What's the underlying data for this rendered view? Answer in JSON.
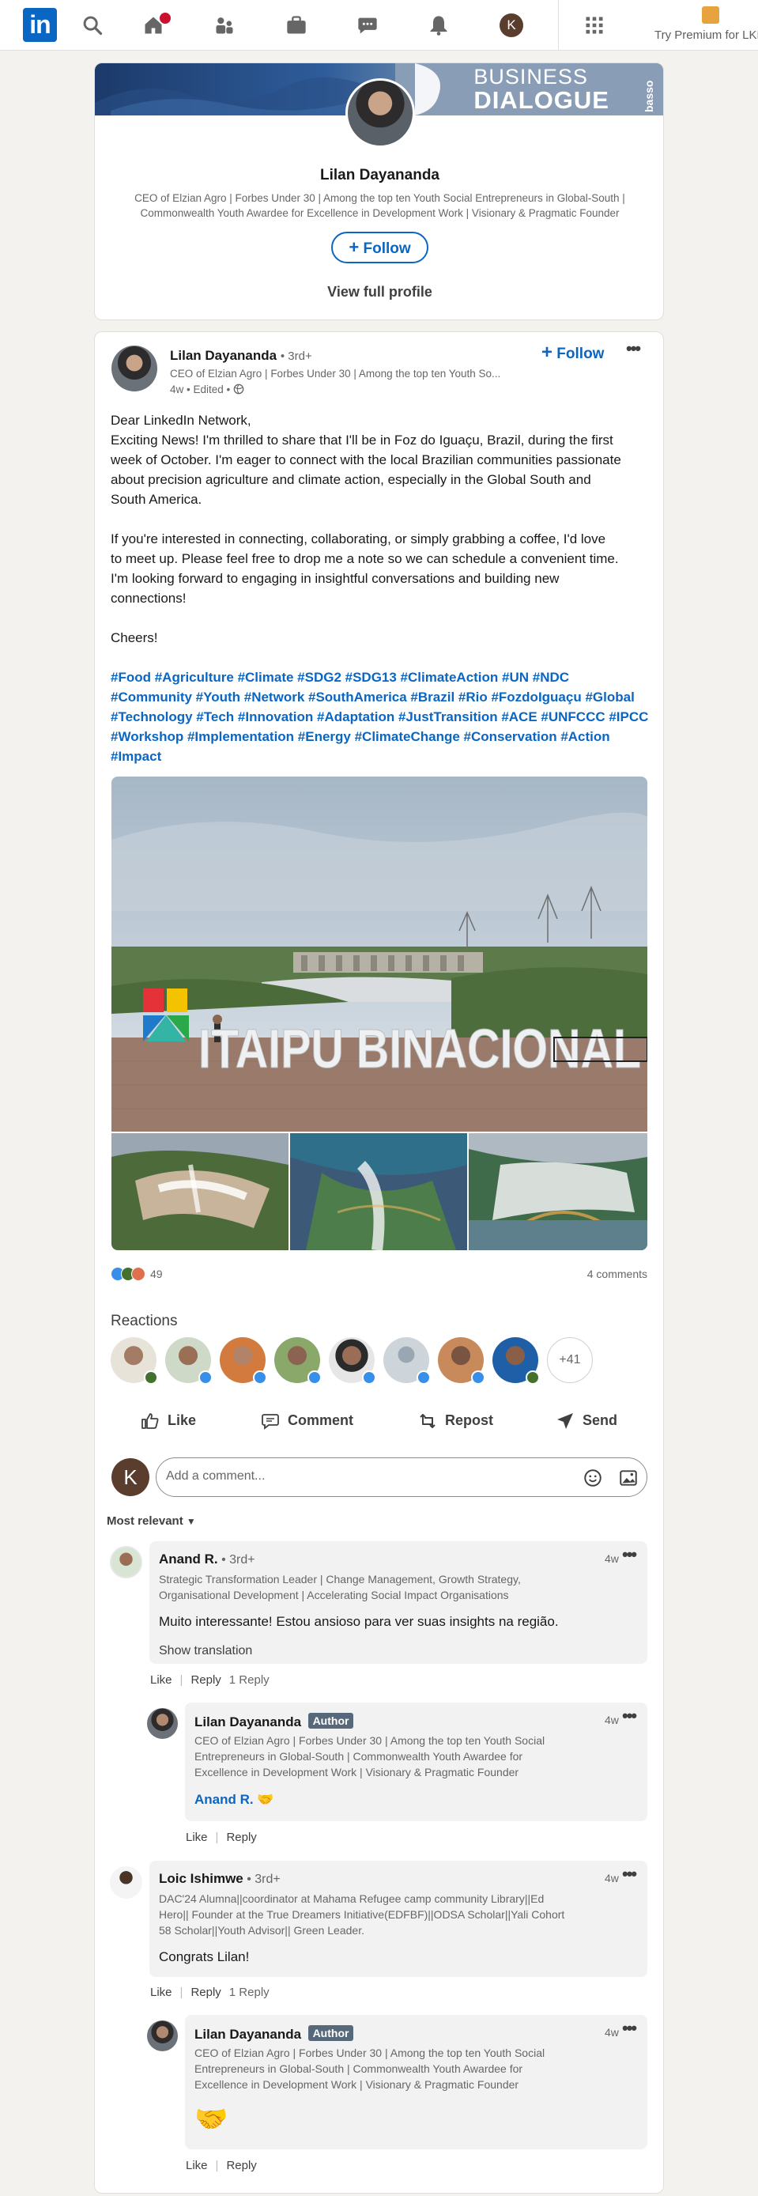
{
  "nav": {
    "logo": "in",
    "premium_label": "Try Premium for LKR"
  },
  "profile_card": {
    "banner_line1": "BUSINESS",
    "banner_line2": "DIALOGUE",
    "banner_side": "basso",
    "name": "Lilan Dayananda",
    "headline_l1": "CEO of Elzian Agro | Forbes Under 30 | Among the top ten Youth Social Entrepreneurs in Global-South |",
    "headline_l2": "Commonwealth Youth Awardee for Excellence in Development Work | Visionary & Pragmatic Founder",
    "follow_label": "Follow",
    "view_profile": "View full profile"
  },
  "post": {
    "author": "Lilan Dayananda",
    "degree": "• 3rd+",
    "headline": "CEO of Elzian Agro | Forbes Under 30 | Among the top ten Youth So...",
    "meta": "4w • Edited •",
    "follow_label": "Follow",
    "p1_l1": "Dear LinkedIn Network,",
    "p1_l2": "Exciting News! I'm thrilled to share that I'll be in Foz do Iguaçu, Brazil, during the first",
    "p1_l3": "week of October. I'm eager to connect with the local Brazilian communities passionate",
    "p1_l4": "about precision agriculture and climate action, especially in the Global South and",
    "p1_l5": "South America.",
    "p2_l1": "If you're interested in connecting, collaborating, or simply grabbing a coffee, I'd love",
    "p2_l2": "to meet up. Please feel free to drop me a note so we can schedule a convenient time.",
    "p2_l3": "I'm looking forward to engaging in insightful conversations and building new",
    "p2_l4": "connections!",
    "p3": "Cheers!",
    "tags_l1": "#Food #Agriculture #Climate #SDG2 #SDG13 #ClimateAction #UN #NDC",
    "tags_l2": "#Community #Youth #Network #SouthAmerica #Brazil #Rio #FozdoIguaçu #Global",
    "tags_l3": "#Technology #Tech #Innovation #Adaptation #JustTransition #ACE #UNFCCC #IPCC",
    "tags_l4": "#Workshop #Implementation #Energy #ClimateChange #Conservation #Action",
    "tags_l5": "#Impact",
    "photo_sign": "ITAIPU BINACIONAL",
    "reactions_count": "49",
    "comments_count": "4 comments",
    "reactions_title": "Reactions",
    "reactions_more": "+41",
    "actions": {
      "like": "Like",
      "comment": "Comment",
      "repost": "Repost",
      "send": "Send"
    },
    "comment_placeholder": "Add a comment...",
    "sort_label": "Most relevant"
  },
  "comments": [
    {
      "name": "Anand R.",
      "degree": "• 3rd+",
      "time": "4w",
      "head_l1": "Strategic Transformation Leader | Change Management, Growth Strategy,",
      "head_l2": "Organisational Development | Accelerating Social Impact Organisations",
      "body": "Muito interessante! Estou ansioso para ver suas insights na região.",
      "translate": "Show translation",
      "like": "Like",
      "reply": "Reply",
      "replies": "1 Reply"
    },
    {
      "name": "Lilan Dayananda",
      "tag": "Author",
      "time": "4w",
      "head_l1": "CEO of Elzian Agro | Forbes Under 30 | Among the top ten Youth Social",
      "head_l2": "Entrepreneurs in Global-South | Commonwealth Youth Awardee for",
      "head_l3": "Excellence in Development Work | Visionary & Pragmatic Founder",
      "mention": "Anand R.",
      "emoji": "🤝",
      "like": "Like",
      "reply": "Reply"
    },
    {
      "name": "Loic Ishimwe",
      "degree": "• 3rd+",
      "time": "4w",
      "head_l1": "DAC'24 Alumna||coordinator at Mahama Refugee camp community Library||Ed",
      "head_l2": "Hero|| Founder at the True Dreamers Initiative(EDFBF)||ODSA Scholar||Yali Cohort",
      "head_l3": "58 Scholar||Youth Advisor|| Green Leader.",
      "body": "Congrats Lilan!",
      "like": "Like",
      "reply": "Reply",
      "replies": "1 Reply"
    },
    {
      "name": "Lilan Dayananda",
      "tag": "Author",
      "time": "4w",
      "head_l1": "CEO of Elzian Agro | Forbes Under 30 | Among the top ten Youth Social",
      "head_l2": "Entrepreneurs in Global-South | Commonwealth Youth Awardee for",
      "head_l3": "Excellence in Development Work | Visionary & Pragmatic Founder",
      "emoji": "🤝",
      "like": "Like",
      "reply": "Reply"
    }
  ],
  "current_user_initial": "K",
  "colors": {
    "brand": "#0a66c2",
    "background": "#f4f2ee",
    "card": "#ffffff"
  }
}
